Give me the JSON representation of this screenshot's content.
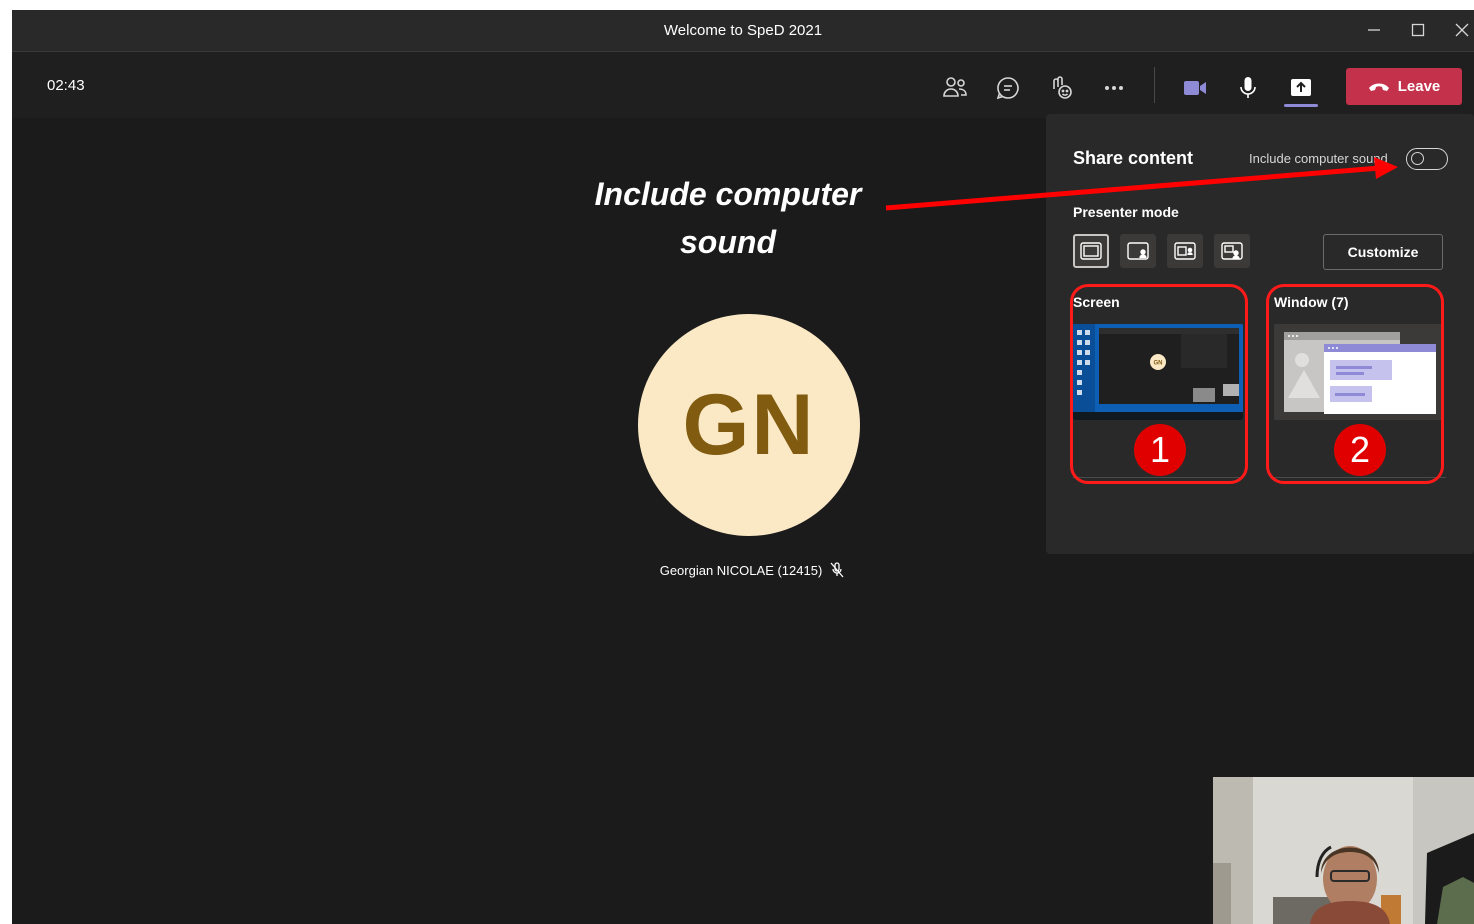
{
  "window": {
    "title": "Welcome to SpeD 2021",
    "controls": [
      "minimize",
      "maximize",
      "close"
    ]
  },
  "toolbar": {
    "timer": "02:43",
    "icons": [
      "people-icon",
      "chat-icon",
      "reactions-icon",
      "more-icon",
      "camera-icon",
      "microphone-icon",
      "share-icon"
    ],
    "leave_label": "Leave"
  },
  "participant": {
    "initials": "GN",
    "name": "Georgian NICOLAE (12415)",
    "muted": true,
    "avatar_bg": "#fbe9c6",
    "avatar_fg": "#805b10"
  },
  "annotation": {
    "line1": "Include computer",
    "line2": "sound",
    "color": "#ff0000"
  },
  "share_panel": {
    "title": "Share content",
    "sound_toggle_label": "Include computer sound",
    "sound_toggle_on": false,
    "presenter_mode_label": "Presenter mode",
    "presenter_modes": [
      "content-only",
      "standout",
      "side-by-side",
      "reporter"
    ],
    "selected_mode": "content-only",
    "customize_label": "Customize",
    "screen_label": "Screen",
    "window_label": "Window (7)",
    "screen_thumb_initials": "GN",
    "badge_1": "1",
    "badge_2": "2"
  },
  "colors": {
    "leave": "#c4314b",
    "accent": "#8f8ad6",
    "highlight": "#ff1a1a"
  }
}
